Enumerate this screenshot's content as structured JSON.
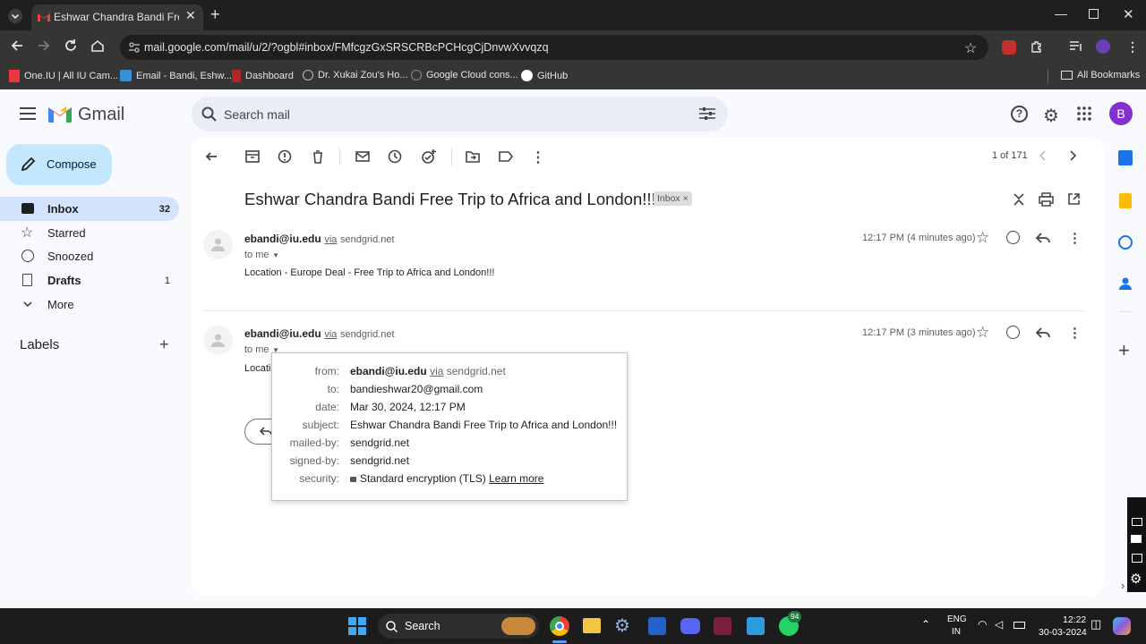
{
  "browser": {
    "tab_title": "Eshwar Chandra Bandi Free Trip",
    "url": "mail.google.com/mail/u/2/?ogbl#inbox/FMfcgzGxSRSCRBcPCHcgCjDnvwXvvqzq",
    "bookmarks": [
      {
        "label": "One.IU | All IU Cam...",
        "icon": "iu-icon",
        "color": "#e8383d"
      },
      {
        "label": "Email - Bandi, Eshw...",
        "icon": "outlook-icon",
        "color": "#3a8fd8"
      },
      {
        "label": "Dashboard",
        "icon": "dashboard-icon",
        "color": "#b2232a"
      },
      {
        "label": "Dr. Xukai Zou's Ho...",
        "icon": "globe-icon",
        "color": "#bbbbbb"
      },
      {
        "label": "Google Cloud cons...",
        "icon": "cloud-icon",
        "color": "#bbbbbb"
      },
      {
        "label": "GitHub",
        "icon": "github-icon",
        "color": "#ffffff"
      }
    ],
    "all_bookmarks": "All Bookmarks"
  },
  "gmail": {
    "brand": "Gmail",
    "search_placeholder": "Search mail",
    "compose": "Compose",
    "avatar_letter": "B",
    "nav": [
      {
        "label": "Inbox",
        "count": "32",
        "icon": "inbox-icon",
        "active": true
      },
      {
        "label": "Starred",
        "count": "",
        "icon": "star-icon"
      },
      {
        "label": "Snoozed",
        "count": "",
        "icon": "clock-icon"
      },
      {
        "label": "Drafts",
        "count": "1",
        "icon": "draft-icon"
      },
      {
        "label": "More",
        "count": "",
        "icon": "chevron-down-icon"
      }
    ],
    "labels_heading": "Labels",
    "pagination": "1 of 171",
    "subject": "Eshwar Chandra Bandi Free Trip to Africa and London!!!",
    "inbox_chip": "Inbox",
    "messages": [
      {
        "sender": "ebandi@iu.edu",
        "via": "via",
        "domain": "sendgrid.net",
        "to": "to me",
        "time": "12:17 PM (4 minutes ago)",
        "body": "Location - Europe Deal - Free Trip to Africa and London!!!"
      },
      {
        "sender": "ebandi@iu.edu",
        "via": "via",
        "domain": "sendgrid.net",
        "to": "to me",
        "time": "12:17 PM (3 minutes ago)",
        "body": "Locati"
      }
    ],
    "details": {
      "from_label": "from:",
      "from_sender": "ebandi@iu.edu",
      "from_via": "via",
      "from_domain": "sendgrid.net",
      "to_label": "to:",
      "to_value": "bandieshwar20@gmail.com",
      "date_label": "date:",
      "date_value": "Mar 30, 2024, 12:17 PM",
      "subject_label": "subject:",
      "subject_value": "Eshwar Chandra Bandi Free Trip to Africa and London!!!",
      "mailedby_label": "mailed-by:",
      "mailedby_value": "sendgrid.net",
      "signedby_label": "signed-by:",
      "signedby_value": "sendgrid.net",
      "security_label": "security:",
      "security_value": "Standard encryption (TLS)",
      "learn_more": "Learn more"
    }
  },
  "taskbar": {
    "search": "Search",
    "lang1": "ENG",
    "lang2": "IN",
    "time": "12:22",
    "date": "30-03-2024",
    "whatsapp_badge": "94"
  },
  "colors": {
    "accent": "#0b57d0",
    "nav_active": "#d3e3fd",
    "compose": "#c2e7ff",
    "avatar": "#8430ce"
  }
}
